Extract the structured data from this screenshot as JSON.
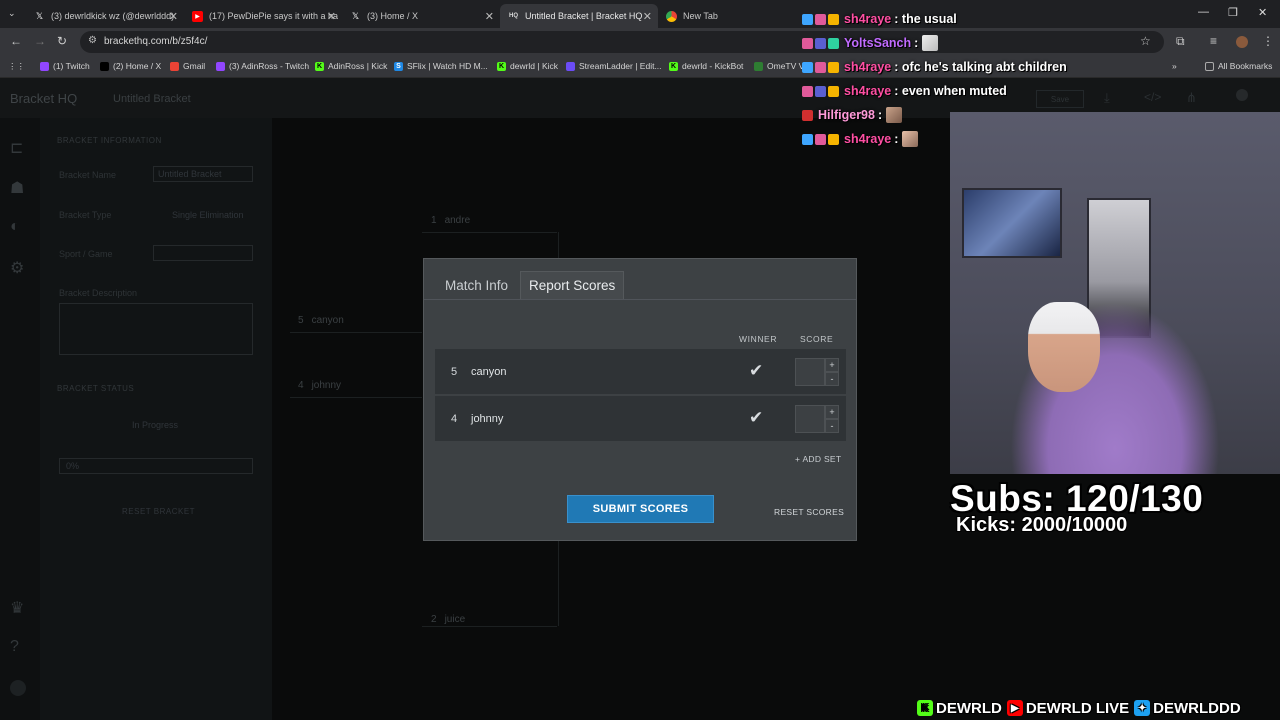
{
  "browser": {
    "tabs": [
      {
        "label": "(3) dewrldkick wz (@dewrlddd)",
        "icon": "x-logo-icon"
      },
      {
        "label": "(17) PewDiePie says it with a ha",
        "icon": "youtube-icon"
      },
      {
        "label": "(3) Home / X",
        "icon": "x-logo-icon"
      },
      {
        "label": "Untitled Bracket | Bracket HQ",
        "icon": "bracket-hq-icon",
        "icon_text": "HQ"
      },
      {
        "label": "New Tab",
        "icon": "chrome-icon"
      }
    ],
    "url": "brackethq.com/b/z5f4c/",
    "bookmarks": [
      {
        "label": "(1) Twitch",
        "color": "#9146ff"
      },
      {
        "label": "(2) Home / X",
        "color": "#000000"
      },
      {
        "label": "Gmail",
        "color": "#ea4335"
      },
      {
        "label": "(3) AdinRoss - Twitch",
        "color": "#9146ff"
      },
      {
        "label": "AdinRoss | Kick",
        "color": "#53fc18"
      },
      {
        "label": "SFlix | Watch HD M...",
        "color": "#1e88e5"
      },
      {
        "label": "dewrld | Kick",
        "color": "#53fc18"
      },
      {
        "label": "StreamLadder | Edit...",
        "color": "#6b4cf6"
      },
      {
        "label": "dewrld - KickBot",
        "color": "#53fc18"
      },
      {
        "label": "OmeTV Vi...",
        "color": "#2e7d32"
      }
    ],
    "all_bookmarks": "All Bookmarks"
  },
  "app": {
    "brand": "Bracket HQ",
    "title": "Untitled Bracket",
    "save_label": "Save",
    "panel": {
      "info_heading": "BRACKET INFORMATION",
      "name_label": "Bracket Name",
      "name_value": "Untitled Bracket",
      "type_label": "Bracket Type",
      "type_value": "Single Elimination",
      "sport_label": "Sport / Game",
      "description_label": "Bracket Description",
      "status_heading": "BRACKET STATUS",
      "status_value": "In Progress",
      "progress_label": "0%",
      "progress": 0,
      "reset_label": "RESET BRACKET"
    },
    "bracket_seeds": [
      {
        "seed": "1",
        "name": "andre"
      },
      {
        "seed": "5",
        "name": "canyon"
      },
      {
        "seed": "4",
        "name": "johnny"
      },
      {
        "seed": "2",
        "name": "juice"
      }
    ]
  },
  "modal": {
    "tab_match_info": "Match Info",
    "tab_report_scores": "Report Scores",
    "winner_header": "WINNER",
    "score_header": "SCORE",
    "rows": [
      {
        "seed": "5",
        "name": "canyon"
      },
      {
        "seed": "4",
        "name": "johnny"
      }
    ],
    "checkmark": "✔",
    "plus": "+",
    "minus": "-",
    "add_set": "+ ADD SET",
    "submit": "SUBMIT SCORES",
    "reset": "RESET SCORES"
  },
  "chat": [
    {
      "user": "sh4raye",
      "color": "#ff4fa3",
      "message": ": the usual"
    },
    {
      "user": "YoltsSanch",
      "color": "#c16bff",
      "message": ":"
    },
    {
      "user": "sh4raye",
      "color": "#ff4fa3",
      "message": ": ofc he's talking abt children"
    },
    {
      "user": "sh4raye",
      "color": "#ff4fa3",
      "message": ": even when muted"
    },
    {
      "user": "Hilfiger98",
      "color": "#ff9ad9",
      "message": ":"
    },
    {
      "user": "sh4raye",
      "color": "#ff4fa3",
      "message": ":"
    }
  ],
  "overlay": {
    "subs": "Subs: 120/130",
    "kicks": "Kicks: 2000/10000",
    "socials": [
      {
        "platform": "kick",
        "label": "DEWRLD",
        "color": "#53fc18"
      },
      {
        "platform": "youtube",
        "label": "DEWRLD LIVE",
        "color": "#ff0000"
      },
      {
        "platform": "twitter",
        "label": "DEWRLDDD",
        "color": "#1da1f2"
      }
    ]
  }
}
